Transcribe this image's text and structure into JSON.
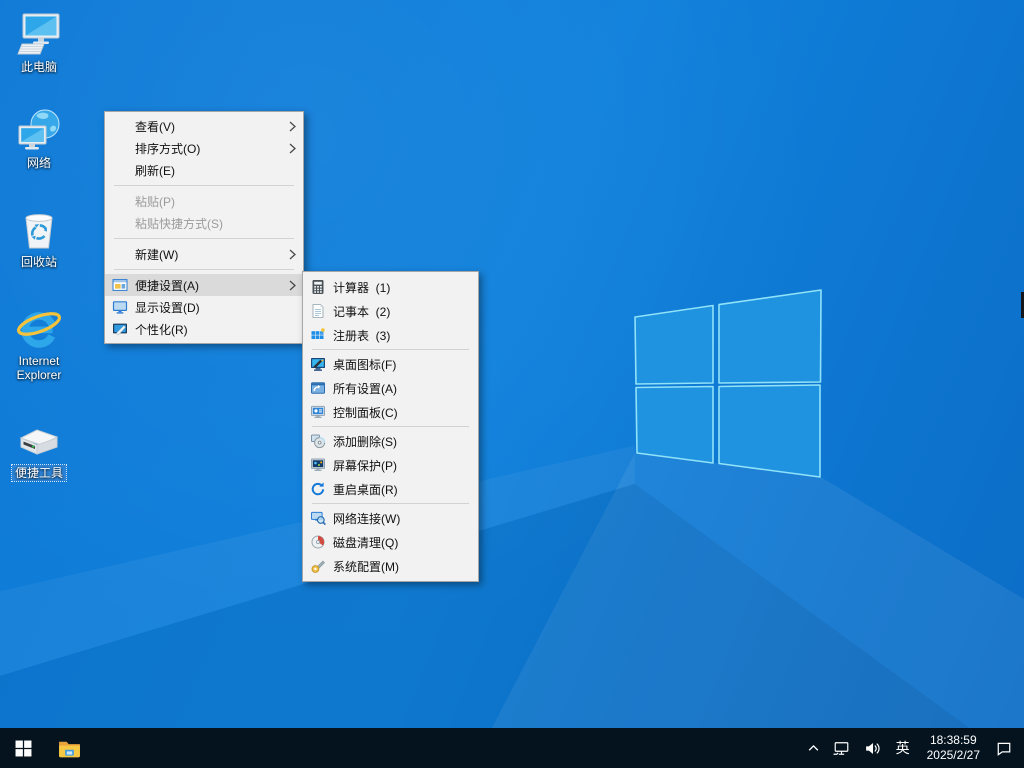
{
  "colors": {
    "wallpaper_base": "#0f7ad6",
    "logo_pane": "#1f93e0",
    "logo_edge": "#8fe2f8",
    "taskbar": "#04131e",
    "menu_background": "#f2f2f2",
    "menu_highlight": "#dadada"
  },
  "desktop": {
    "icons": [
      {
        "name": "this-pc",
        "label": "此电脑",
        "icon": "this-pc-icon",
        "selected": false
      },
      {
        "name": "network",
        "label": "网络",
        "icon": "network-globe-icon",
        "selected": false
      },
      {
        "name": "recycle-bin",
        "label": "回收站",
        "icon": "recycle-bin-icon",
        "selected": false
      },
      {
        "name": "internet-explorer",
        "label": "Internet Explorer",
        "icon": "internet-explorer-icon",
        "selected": false
      },
      {
        "name": "tools-drive",
        "label": "便捷工具",
        "icon": "external-drive-icon",
        "selected": true
      }
    ]
  },
  "context_menu": {
    "items": [
      {
        "type": "item",
        "name": "view",
        "label": "查看(V)",
        "submenu": true
      },
      {
        "type": "item",
        "name": "sort-by",
        "label": "排序方式(O)",
        "submenu": true
      },
      {
        "type": "item",
        "name": "refresh",
        "label": "刷新(E)"
      },
      {
        "type": "separator"
      },
      {
        "type": "item",
        "name": "paste",
        "label": "粘贴(P)",
        "disabled": true
      },
      {
        "type": "item",
        "name": "paste-shortcut",
        "label": "粘贴快捷方式(S)",
        "disabled": true
      },
      {
        "type": "separator"
      },
      {
        "type": "item",
        "name": "new",
        "label": "新建(W)",
        "submenu": true
      },
      {
        "type": "separator"
      },
      {
        "type": "item",
        "name": "quick-settings",
        "label": "便捷设置(A)",
        "icon": "quick-settings",
        "submenu": true,
        "highlighted": true
      },
      {
        "type": "item",
        "name": "display-settings",
        "label": "显示设置(D)",
        "icon": "display-settings"
      },
      {
        "type": "item",
        "name": "personalize",
        "label": "个性化(R)",
        "icon": "personalize"
      }
    ]
  },
  "submenu": {
    "items": [
      {
        "type": "item",
        "name": "calculator",
        "label": "计算器  (1)",
        "icon": "calculator"
      },
      {
        "type": "item",
        "name": "notepad",
        "label": "记事本  (2)",
        "icon": "notepad"
      },
      {
        "type": "item",
        "name": "registry",
        "label": "注册表  (3)",
        "icon": "registry"
      },
      {
        "type": "separator"
      },
      {
        "type": "item",
        "name": "desktop-icons",
        "label": "桌面图标(F)",
        "icon": "desktop-icons"
      },
      {
        "type": "item",
        "name": "all-settings",
        "label": "所有设置(A)",
        "icon": "all-settings"
      },
      {
        "type": "item",
        "name": "control-panel",
        "label": "控制面板(C)",
        "icon": "control-panel"
      },
      {
        "type": "separator"
      },
      {
        "type": "item",
        "name": "add-remove",
        "label": "添加删除(S)",
        "icon": "add-remove"
      },
      {
        "type": "item",
        "name": "screensaver",
        "label": "屏幕保护(P)",
        "icon": "screensaver"
      },
      {
        "type": "item",
        "name": "restart-desktop",
        "label": "重启桌面(R)",
        "icon": "restart-desktop"
      },
      {
        "type": "separator"
      },
      {
        "type": "item",
        "name": "network-connections",
        "label": "网络连接(W)",
        "icon": "network-connections"
      },
      {
        "type": "item",
        "name": "disk-cleanup",
        "label": "磁盘清理(Q)",
        "icon": "disk-cleanup"
      },
      {
        "type": "item",
        "name": "system-config",
        "label": "系统配置(M)",
        "icon": "system-config"
      }
    ]
  },
  "taskbar": {
    "buttons": [
      {
        "name": "start",
        "icon": "windows-start-icon"
      },
      {
        "name": "file-explorer",
        "icon": "file-explorer-icon"
      }
    ],
    "tray": {
      "icons": [
        "hidden-icons-chevron",
        "network-status-icon",
        "volume-icon",
        "action-center-icon"
      ],
      "language": "英",
      "time": "18:38:59",
      "date": "2025/2/27"
    }
  }
}
